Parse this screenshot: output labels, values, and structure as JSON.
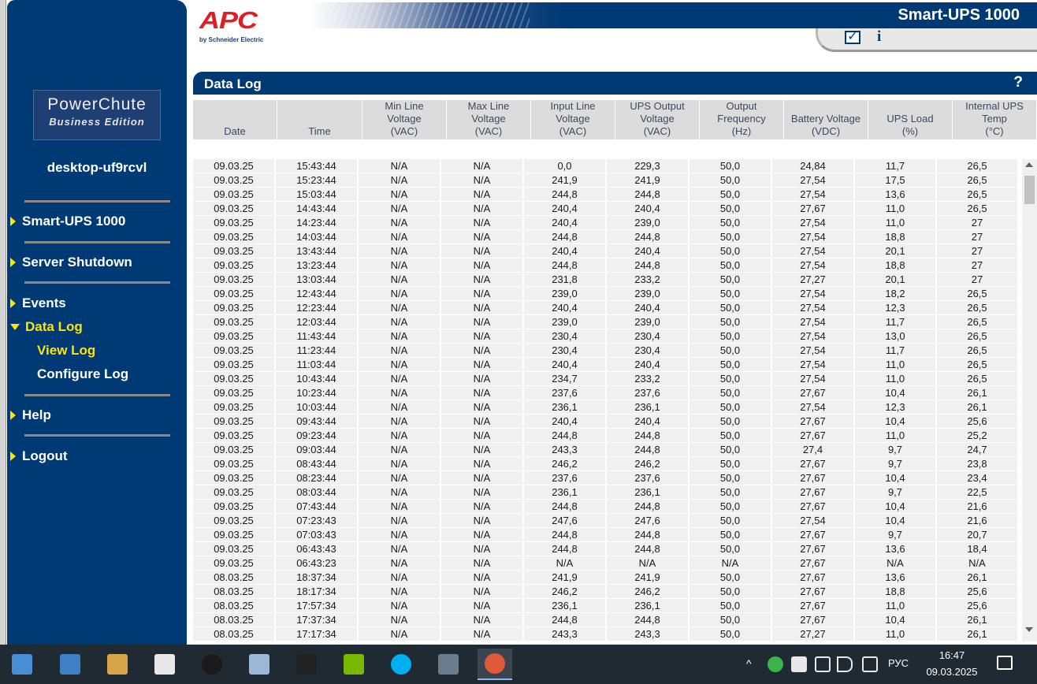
{
  "header": {
    "brand": "APC",
    "brand_sub": "by Schneider Electric",
    "product_title": "Smart-UPS 1000"
  },
  "sidebar": {
    "logo_title": "PowerChute",
    "logo_subtitle": "Business Edition",
    "hostname": "desktop-uf9rcvl",
    "items": [
      {
        "label": "Smart-UPS 1000"
      },
      {
        "label": "Server Shutdown"
      },
      {
        "label": "Events"
      },
      {
        "label": "Data Log"
      },
      {
        "label": "Help"
      },
      {
        "label": "Logout"
      }
    ],
    "subitems": [
      {
        "label": "View Log"
      },
      {
        "label": "Configure Log"
      }
    ]
  },
  "content": {
    "title": "Data Log",
    "help": "?"
  },
  "table": {
    "columns": [
      {
        "line1": "",
        "line2": "",
        "line3": "Date"
      },
      {
        "line1": "",
        "line2": "",
        "line3": "Time"
      },
      {
        "line1": "Min Line",
        "line2": "Voltage",
        "line3": "(VAC)"
      },
      {
        "line1": "Max Line",
        "line2": "Voltage",
        "line3": "(VAC)"
      },
      {
        "line1": "Input Line",
        "line2": "Voltage",
        "line3": "(VAC)"
      },
      {
        "line1": "UPS Output",
        "line2": "Voltage",
        "line3": "(VAC)"
      },
      {
        "line1": "Output",
        "line2": "Frequency",
        "line3": "(Hz)"
      },
      {
        "line1": "",
        "line2": "Battery Voltage",
        "line3": "(VDC)"
      },
      {
        "line1": "",
        "line2": "UPS Load",
        "line3": "(%)"
      },
      {
        "line1": "Internal UPS",
        "line2": "Temp",
        "line3": "(°C)"
      }
    ],
    "rows": [
      [
        "09.03.25",
        "15:43:44",
        "N/A",
        "N/A",
        "0,0",
        "229,3",
        "50,0",
        "24,84",
        "11,7",
        "26,5"
      ],
      [
        "09.03.25",
        "15:23:44",
        "N/A",
        "N/A",
        "241,9",
        "241,9",
        "50,0",
        "27,54",
        "17,5",
        "26,5"
      ],
      [
        "09.03.25",
        "15:03:44",
        "N/A",
        "N/A",
        "244,8",
        "244,8",
        "50,0",
        "27,54",
        "13,6",
        "26,5"
      ],
      [
        "09.03.25",
        "14:43:44",
        "N/A",
        "N/A",
        "240,4",
        "240,4",
        "50,0",
        "27,67",
        "11,0",
        "26,5"
      ],
      [
        "09.03.25",
        "14:23:44",
        "N/A",
        "N/A",
        "240,4",
        "239,0",
        "50,0",
        "27,54",
        "11,0",
        "27"
      ],
      [
        "09.03.25",
        "14:03:44",
        "N/A",
        "N/A",
        "244,8",
        "244,8",
        "50,0",
        "27,54",
        "18,8",
        "27"
      ],
      [
        "09.03.25",
        "13:43:44",
        "N/A",
        "N/A",
        "240,4",
        "240,4",
        "50,0",
        "27,54",
        "20,1",
        "27"
      ],
      [
        "09.03.25",
        "13:23:44",
        "N/A",
        "N/A",
        "244,8",
        "244,8",
        "50,0",
        "27,54",
        "18,8",
        "27"
      ],
      [
        "09.03.25",
        "13:03:44",
        "N/A",
        "N/A",
        "231,8",
        "233,2",
        "50,0",
        "27,27",
        "20,1",
        "27"
      ],
      [
        "09.03.25",
        "12:43:44",
        "N/A",
        "N/A",
        "239,0",
        "239,0",
        "50,0",
        "27,54",
        "18,2",
        "26,5"
      ],
      [
        "09.03.25",
        "12:23:44",
        "N/A",
        "N/A",
        "240,4",
        "240,4",
        "50,0",
        "27,54",
        "12,3",
        "26,5"
      ],
      [
        "09.03.25",
        "12:03:44",
        "N/A",
        "N/A",
        "239,0",
        "239,0",
        "50,0",
        "27,54",
        "11,7",
        "26,5"
      ],
      [
        "09.03.25",
        "11:43:44",
        "N/A",
        "N/A",
        "230,4",
        "230,4",
        "50,0",
        "27,54",
        "13,0",
        "26,5"
      ],
      [
        "09.03.25",
        "11:23:44",
        "N/A",
        "N/A",
        "230,4",
        "230,4",
        "50,0",
        "27,54",
        "11,7",
        "26,5"
      ],
      [
        "09.03.25",
        "11:03:44",
        "N/A",
        "N/A",
        "240,4",
        "240,4",
        "50,0",
        "27,54",
        "11,0",
        "26,5"
      ],
      [
        "09.03.25",
        "10:43:44",
        "N/A",
        "N/A",
        "234,7",
        "233,2",
        "50,0",
        "27,54",
        "11,0",
        "26,5"
      ],
      [
        "09.03.25",
        "10:23:44",
        "N/A",
        "N/A",
        "237,6",
        "237,6",
        "50,0",
        "27,67",
        "10,4",
        "26,1"
      ],
      [
        "09.03.25",
        "10:03:44",
        "N/A",
        "N/A",
        "236,1",
        "236,1",
        "50,0",
        "27,54",
        "12,3",
        "26,1"
      ],
      [
        "09.03.25",
        "09:43:44",
        "N/A",
        "N/A",
        "240,4",
        "240,4",
        "50,0",
        "27,67",
        "10,4",
        "25,6"
      ],
      [
        "09.03.25",
        "09:23:44",
        "N/A",
        "N/A",
        "244,8",
        "244,8",
        "50,0",
        "27,67",
        "11,0",
        "25,2"
      ],
      [
        "09.03.25",
        "09:03:44",
        "N/A",
        "N/A",
        "243,3",
        "244,8",
        "50,0",
        "27,4",
        "9,7",
        "24,7"
      ],
      [
        "09.03.25",
        "08:43:44",
        "N/A",
        "N/A",
        "246,2",
        "246,2",
        "50,0",
        "27,67",
        "9,7",
        "23,8"
      ],
      [
        "09.03.25",
        "08:23:44",
        "N/A",
        "N/A",
        "237,6",
        "237,6",
        "50,0",
        "27,67",
        "10,4",
        "23,4"
      ],
      [
        "09.03.25",
        "08:03:44",
        "N/A",
        "N/A",
        "236,1",
        "236,1",
        "50,0",
        "27,67",
        "9,7",
        "22,5"
      ],
      [
        "09.03.25",
        "07:43:44",
        "N/A",
        "N/A",
        "244,8",
        "244,8",
        "50,0",
        "27,67",
        "10,4",
        "21,6"
      ],
      [
        "09.03.25",
        "07:23:43",
        "N/A",
        "N/A",
        "247,6",
        "247,6",
        "50,0",
        "27,54",
        "10,4",
        "21,6"
      ],
      [
        "09.03.25",
        "07:03:43",
        "N/A",
        "N/A",
        "244,8",
        "244,8",
        "50,0",
        "27,67",
        "9,7",
        "20,7"
      ],
      [
        "09.03.25",
        "06:43:43",
        "N/A",
        "N/A",
        "244,8",
        "244,8",
        "50,0",
        "27,67",
        "13,6",
        "18,4"
      ],
      [
        "09.03.25",
        "06:43:23",
        "N/A",
        "N/A",
        "N/A",
        "N/A",
        "N/A",
        "27,67",
        "N/A",
        "N/A"
      ],
      [
        "08.03.25",
        "18:37:34",
        "N/A",
        "N/A",
        "241,9",
        "241,9",
        "50,0",
        "27,67",
        "13,6",
        "26,1"
      ],
      [
        "08.03.25",
        "18:17:34",
        "N/A",
        "N/A",
        "246,2",
        "246,2",
        "50,0",
        "27,67",
        "18,8",
        "25,6"
      ],
      [
        "08.03.25",
        "17:57:34",
        "N/A",
        "N/A",
        "236,1",
        "236,1",
        "50,0",
        "27,67",
        "11,0",
        "25,6"
      ],
      [
        "08.03.25",
        "17:37:34",
        "N/A",
        "N/A",
        "244,8",
        "244,8",
        "50,0",
        "27,67",
        "10,4",
        "26,1"
      ],
      [
        "08.03.25",
        "17:17:34",
        "N/A",
        "N/A",
        "243,3",
        "243,3",
        "50,0",
        "27,27",
        "11,0",
        "26,1"
      ]
    ]
  },
  "taskbar": {
    "apps": [
      {
        "icon": "notepad-icon",
        "color": "#4a8fd6"
      },
      {
        "icon": "wordpad-icon",
        "color": "#3f7fc4"
      },
      {
        "icon": "paint-icon",
        "color": "#d9a54a"
      },
      {
        "icon": "calculator-icon",
        "color": "#e8e8e8"
      },
      {
        "icon": "sphere-icon",
        "color": "#1a1a1a"
      },
      {
        "icon": "monitor-icon",
        "color": "#9cb8d6"
      },
      {
        "icon": "terminal-icon",
        "color": "#222222"
      },
      {
        "icon": "nvidia-icon",
        "color": "#76b900"
      },
      {
        "icon": "skype-icon",
        "color": "#00aff0"
      },
      {
        "icon": "photo-icon",
        "color": "#6b7d8c"
      },
      {
        "icon": "browser-icon",
        "color": "#e05a3a"
      }
    ],
    "tray_icons": [
      "shield-icon",
      "nvidia-tray-icon",
      "pen-icon",
      "volume-icon",
      "network-icon"
    ],
    "language": "РУС",
    "time": "16:47",
    "date": "09.03.2025"
  }
}
